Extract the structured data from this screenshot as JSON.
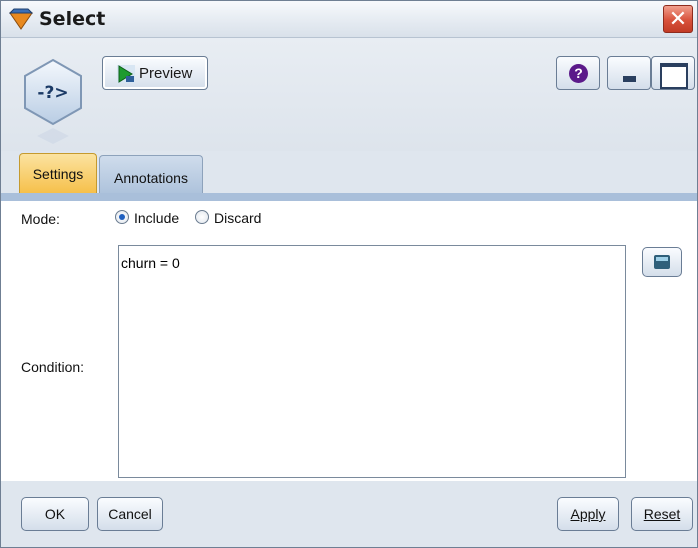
{
  "window": {
    "title": "Select",
    "close_glyph": "✕",
    "title_icon": "select-node-icon"
  },
  "toolbar": {
    "preview_label": "Preview",
    "help_glyph": "?",
    "node_glyph": "-?>"
  },
  "tabs": [
    {
      "label": "Settings",
      "active": true
    },
    {
      "label": "Annotations",
      "active": false
    }
  ],
  "settings": {
    "mode_label": "Mode:",
    "mode_options": [
      "Include",
      "Discard"
    ],
    "mode_selected": "Include",
    "condition_label": "Condition:",
    "condition_value": "churn = 0"
  },
  "buttons": {
    "ok": "OK",
    "cancel": "Cancel",
    "apply": "Apply",
    "reset": "Reset"
  },
  "colors": {
    "active_tab": "#f6c04b",
    "close_button": "#d8513b",
    "accent": "#1f5fbf"
  }
}
